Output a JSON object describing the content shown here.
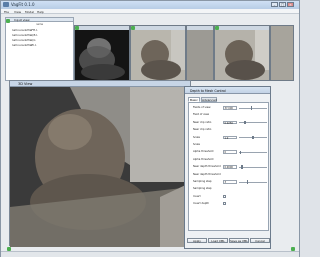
{
  "window": {
    "title": "VagFit 0.1.0"
  },
  "menu": [
    "File",
    "View",
    "Model",
    "Help"
  ],
  "input_view": {
    "title": "Input view",
    "column": "name",
    "files": [
      "lumnunu123aFH.I.",
      "lumnunu123aQ3.I.",
      "lumnunu123aQ.I.",
      "lumnunu123aEl.I."
    ]
  },
  "view3d": {
    "title": "3D View"
  },
  "dialog": {
    "title": "Depth to Mesh Control",
    "tabs": [
      "Basic",
      "Advanced"
    ],
    "params": [
      {
        "label": "Fields of view",
        "value": "37.000",
        "level": 0.45
      },
      {
        "label": "Field of view",
        "value": "",
        "level": null
      },
      {
        "label": "Near clip ratio",
        "value": "0.0250",
        "level": 0.22
      },
      {
        "label": "Near clip ratio",
        "value": "",
        "level": null
      },
      {
        "label": "Scale",
        "value": "1.0",
        "level": 0.5
      },
      {
        "label": "Scale",
        "value": "",
        "level": null
      },
      {
        "label": "Alpha threshold",
        "value": "0",
        "level": 0.05
      },
      {
        "label": "Alpha threshold",
        "value": "",
        "level": null
      },
      {
        "label": "Near depth threshold",
        "value": "0.0000",
        "level": 0.1
      },
      {
        "label": "Near depth threshold",
        "value": "",
        "level": null
      },
      {
        "label": "Sampling step",
        "value": "3",
        "level": 0.3
      },
      {
        "label": "Sampling step",
        "value": "",
        "level": null
      },
      {
        "label": "Invert",
        "value": "",
        "level": null
      },
      {
        "label": "Invert depth",
        "value": "",
        "level": null
      }
    ],
    "buttons": [
      "Apply",
      "Load XML",
      "Save as XML",
      "Cancel"
    ]
  },
  "colors": {
    "accent": "#4caf50",
    "titlebar": "#c2d2e6"
  }
}
